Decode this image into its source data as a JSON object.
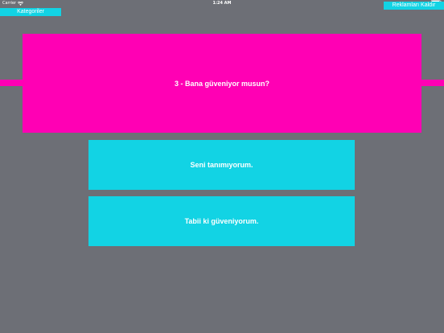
{
  "status_bar": {
    "carrier": "Carrier",
    "time": "1:24 AM",
    "icons": [
      "wifi-icon",
      "battery-icon"
    ]
  },
  "nav": {
    "categories_label": "Kategoriler",
    "remove_ads_label": "Reklamları Kaldır"
  },
  "question": {
    "text": "3 - Bana güveniyor musun?"
  },
  "answers": [
    {
      "label": "Seni tanımıyorum."
    },
    {
      "label": "Tabii ki güveniyorum."
    }
  ],
  "colors": {
    "background": "#6d6f76",
    "question_bg": "#ff00b4",
    "button_bg": "#12d3e4",
    "text": "#ffffff"
  }
}
